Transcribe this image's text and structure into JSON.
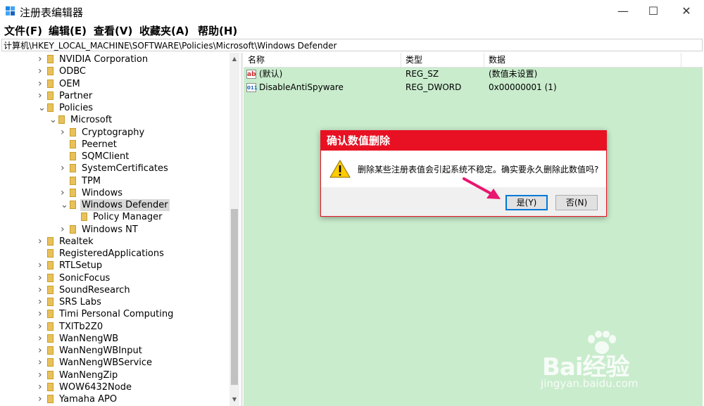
{
  "window": {
    "title": "注册表编辑器",
    "minimize_glyph": "—",
    "maximize_glyph": "☐",
    "close_glyph": "✕"
  },
  "menu": [
    "文件(F)",
    "编辑(E)",
    "查看(V)",
    "收藏夹(A)",
    "帮助(H)"
  ],
  "address": "计算机\\HKEY_LOCAL_MACHINE\\SOFTWARE\\Policies\\Microsoft\\Windows Defender",
  "tree": [
    {
      "label": "NVIDIA Corporation",
      "level": 0,
      "expander": "collapsed"
    },
    {
      "label": "ODBC",
      "level": 0,
      "expander": "collapsed"
    },
    {
      "label": "OEM",
      "level": 0,
      "expander": "collapsed"
    },
    {
      "label": "Partner",
      "level": 0,
      "expander": "collapsed"
    },
    {
      "label": "Policies",
      "level": 0,
      "expander": "expanded"
    },
    {
      "label": "Microsoft",
      "level": 1,
      "expander": "expanded"
    },
    {
      "label": "Cryptography",
      "level": 2,
      "expander": "collapsed"
    },
    {
      "label": "Peernet",
      "level": 2,
      "expander": "none"
    },
    {
      "label": "SQMClient",
      "level": 2,
      "expander": "none"
    },
    {
      "label": "SystemCertificates",
      "level": 2,
      "expander": "collapsed"
    },
    {
      "label": "TPM",
      "level": 2,
      "expander": "none"
    },
    {
      "label": "Windows",
      "level": 2,
      "expander": "collapsed"
    },
    {
      "label": "Windows Defender",
      "level": 2,
      "expander": "expanded",
      "selected": true
    },
    {
      "label": "Policy Manager",
      "level": 3,
      "expander": "none"
    },
    {
      "label": "Windows NT",
      "level": 2,
      "expander": "collapsed"
    },
    {
      "label": "Realtek",
      "level": 0,
      "expander": "collapsed"
    },
    {
      "label": "RegisteredApplications",
      "level": 0,
      "expander": "none"
    },
    {
      "label": "RTLSetup",
      "level": 0,
      "expander": "collapsed"
    },
    {
      "label": "SonicFocus",
      "level": 0,
      "expander": "collapsed"
    },
    {
      "label": "SoundResearch",
      "level": 0,
      "expander": "collapsed"
    },
    {
      "label": "SRS Labs",
      "level": 0,
      "expander": "collapsed"
    },
    {
      "label": "Timi Personal Computing",
      "level": 0,
      "expander": "collapsed"
    },
    {
      "label": "TXlTb2Z0",
      "level": 0,
      "expander": "collapsed"
    },
    {
      "label": "WanNengWB",
      "level": 0,
      "expander": "collapsed"
    },
    {
      "label": "WanNengWBInput",
      "level": 0,
      "expander": "collapsed"
    },
    {
      "label": "WanNengWBService",
      "level": 0,
      "expander": "collapsed"
    },
    {
      "label": "WanNengZip",
      "level": 0,
      "expander": "collapsed"
    },
    {
      "label": "WOW6432Node",
      "level": 0,
      "expander": "collapsed"
    },
    {
      "label": "Yamaha APO",
      "level": 0,
      "expander": "collapsed"
    }
  ],
  "list": {
    "columns": [
      "名称",
      "类型",
      "数据"
    ],
    "rows": [
      {
        "name": "(默认)",
        "type": "REG_SZ",
        "data": "(数值未设置)",
        "icon": "string-value-icon",
        "icon_glyph": "ab"
      },
      {
        "name": "DisableAntiSpyware",
        "type": "REG_DWORD",
        "data": "0x00000001 (1)",
        "icon": "binary-value-icon",
        "icon_glyph": "011"
      }
    ]
  },
  "dialog": {
    "title": "确认数值删除",
    "message": "删除某些注册表值会引起系统不稳定。确实要永久删除此数值吗?",
    "yes_label": "是(Y)",
    "no_label": "否(N)"
  },
  "watermark": {
    "brand": "Bai经验",
    "url": "jingyan.baidu.com"
  },
  "colors": {
    "list_background": "#c9eccd",
    "dialog_title_bar": "#e81123",
    "arrow": "#e8176f"
  }
}
